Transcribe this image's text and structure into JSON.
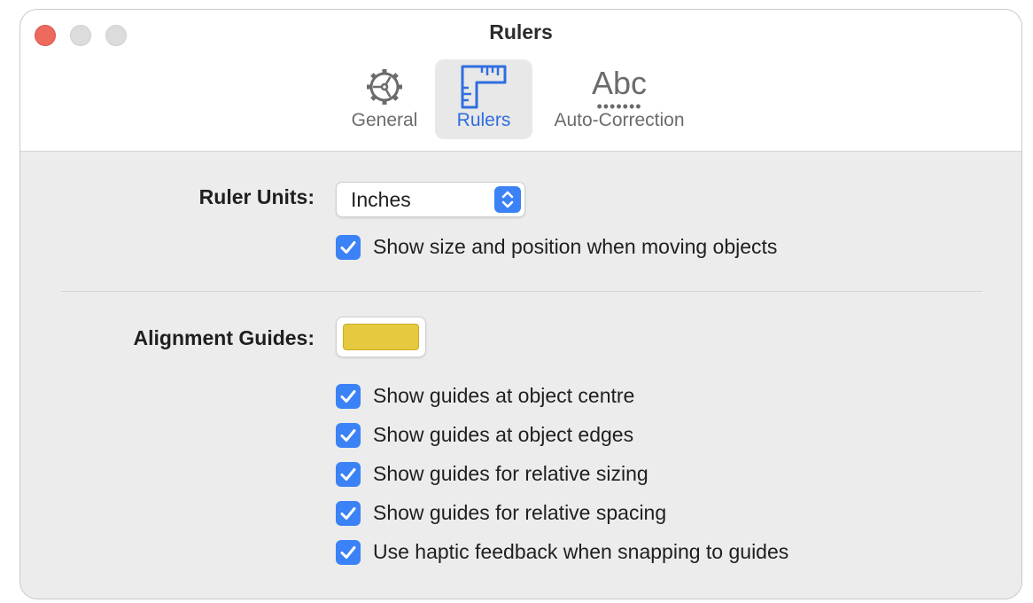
{
  "window": {
    "title": "Rulers"
  },
  "toolbar": {
    "items": [
      {
        "label": "General",
        "icon": "gear-icon",
        "selected": false
      },
      {
        "label": "Rulers",
        "icon": "ruler-icon",
        "selected": true
      },
      {
        "label": "Auto-Correction",
        "icon": "abc-text-icon",
        "icon_text": "Abc",
        "selected": false
      }
    ]
  },
  "ruler_units": {
    "label": "Ruler Units:",
    "selected": "Inches",
    "show_size_label": "Show size and position when moving objects",
    "show_size_checked": true
  },
  "alignment_guides": {
    "label": "Alignment Guides:",
    "color": "#e6c93f",
    "options": [
      {
        "label": "Show guides at object centre",
        "checked": true
      },
      {
        "label": "Show guides at object edges",
        "checked": true
      },
      {
        "label": "Show guides for relative sizing",
        "checked": true
      },
      {
        "label": "Show guides for relative spacing",
        "checked": true
      },
      {
        "label": "Use haptic feedback when snapping to guides",
        "checked": true
      }
    ]
  },
  "colors": {
    "accent": "#3b82f6",
    "selected_tab_text": "#2f6ee0",
    "close_button": "#ee6a5f",
    "guide_color": "#e6c93f"
  }
}
